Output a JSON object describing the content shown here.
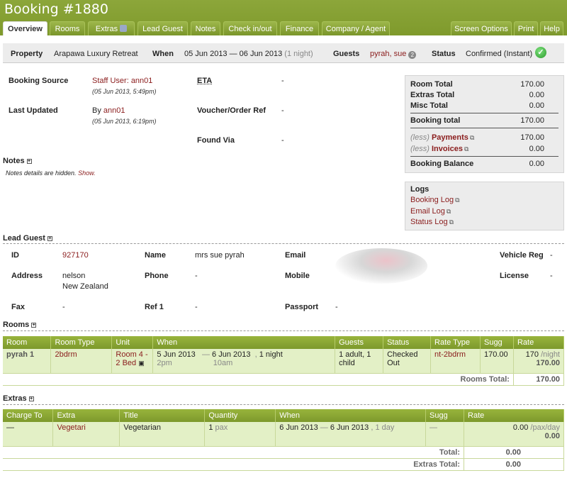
{
  "booking": {
    "title": "Booking #1880"
  },
  "tabs": [
    {
      "label": "Overview"
    },
    {
      "label": "Rooms"
    },
    {
      "label": "Extras"
    },
    {
      "label": "Lead Guest"
    },
    {
      "label": "Notes"
    },
    {
      "label": "Check in/out"
    },
    {
      "label": "Finance"
    },
    {
      "label": "Company / Agent"
    }
  ],
  "right_tabs": [
    {
      "label": "Screen Options"
    },
    {
      "label": "Print"
    },
    {
      "label": "Help"
    }
  ],
  "summary": {
    "property_label": "Property",
    "property": "Arapawa Luxury Retreat",
    "when_label": "When",
    "when": "05 Jun 2013 — 06 Jun 2013",
    "nights": "(1 night)",
    "guests_label": "Guests",
    "guests": "pyrah, sue",
    "guests_count": "2",
    "status_label": "Status",
    "status": "Confirmed (Instant)"
  },
  "details": {
    "booking_source_label": "Booking Source",
    "booking_source": "Staff User: ann01",
    "booking_source_date": "(05 Jun 2013, 5:49pm)",
    "last_updated_label": "Last Updated",
    "last_updated_by": "By",
    "last_updated_user": "ann01",
    "last_updated_date": "(05 Jun 2013, 6:19pm)",
    "eta_label": "ETA",
    "eta": "-",
    "voucher_label": "Voucher/Order Ref",
    "voucher": "-",
    "found_via_label": "Found Via",
    "found_via": "-"
  },
  "notes": {
    "title": "Notes",
    "hidden_text": "Notes details are hidden.",
    "show_link": "Show."
  },
  "totals": {
    "room_total_label": "Room Total",
    "room_total": "170.00",
    "extras_total_label": "Extras Total",
    "extras_total": "0.00",
    "misc_total_label": "Misc Total",
    "misc_total": "0.00",
    "booking_total_label": "Booking total",
    "booking_total": "170.00",
    "less": "(less)",
    "payments_label": "Payments",
    "payments": "170.00",
    "invoices_label": "Invoices",
    "invoices": "0.00",
    "balance_label": "Booking Balance",
    "balance": "0.00"
  },
  "logs": {
    "title": "Logs",
    "booking_log": "Booking Log",
    "email_log": "Email Log",
    "status_log": "Status Log"
  },
  "lead_guest": {
    "title": "Lead Guest",
    "id_label": "ID",
    "id": "927170",
    "name_label": "Name",
    "name": "mrs sue pyrah",
    "email_label": "Email",
    "vehicle_label": "Vehicle Reg",
    "vehicle": "-",
    "address_label": "Address",
    "address_line1": "nelson",
    "address_line2": "New Zealand",
    "phone_label": "Phone",
    "phone": "-",
    "mobile_label": "Mobile",
    "license_label": "License",
    "license": "-",
    "fax_label": "Fax",
    "fax": "-",
    "ref1_label": "Ref 1",
    "ref1": "-",
    "passport_label": "Passport",
    "passport": "-"
  },
  "rooms": {
    "title": "Rooms",
    "headers": [
      "Room",
      "Room Type",
      "Unit",
      "When",
      "Guests",
      "Status",
      "Rate Type",
      "Sugg",
      "Rate"
    ],
    "row": {
      "room": "pyrah 1",
      "room_type": "2bdrm",
      "unit": "Room 4 - 2 Bed",
      "when_start": "5 Jun 2013",
      "when_dash": "—",
      "when_end": "6 Jun 2013",
      "when_comma": ",",
      "when_nights": "1 night",
      "start_time": "2pm",
      "end_time": "10am",
      "guests": "1 adult, 1 child",
      "status": "Checked Out",
      "rate_type": "nt-2bdrm",
      "sugg": "170.00",
      "rate": "170",
      "rate_unit": "/night",
      "rate_total": "170.00"
    },
    "total_label": "Rooms Total:",
    "total": "170.00"
  },
  "extras": {
    "title": "Extras",
    "headers": [
      "Charge To",
      "Extra",
      "Title",
      "Quantity",
      "When",
      "Sugg",
      "Rate"
    ],
    "row": {
      "charge_to": "—",
      "extra": "Vegetari",
      "title": "Vegetarian",
      "quantity": "1",
      "quantity_unit": "pax",
      "when_start": "6 Jun 2013",
      "when_dash": "—",
      "when_end": "6 Jun 2013",
      "when_comma": ",",
      "when_days": "1 day",
      "sugg": "—",
      "rate": "0.00",
      "rate_unit": "/pax/day",
      "rate_total": "0.00"
    },
    "total_label": "Total:",
    "total": "0.00",
    "extras_total_label": "Extras Total:",
    "extras_total": "0.00"
  }
}
